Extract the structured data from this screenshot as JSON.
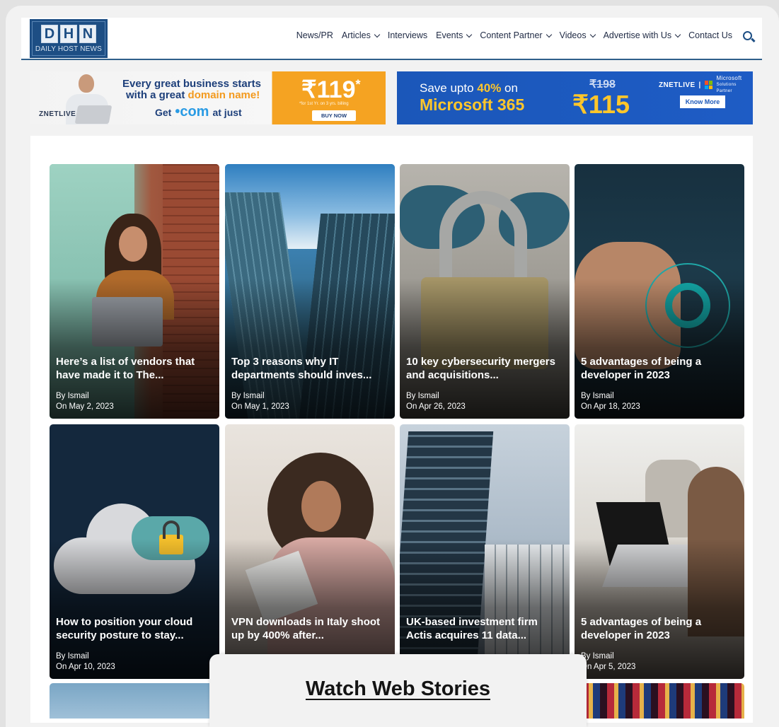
{
  "site": {
    "logo_letters": [
      "D",
      "H",
      "N"
    ],
    "logo_subtitle": "DAILY HOST NEWS"
  },
  "nav": {
    "items": [
      {
        "label": "News/PR",
        "dropdown": false
      },
      {
        "label": "Articles",
        "dropdown": true
      },
      {
        "label": "Interviews",
        "dropdown": false
      },
      {
        "label": "Events",
        "dropdown": true
      },
      {
        "label": "Content Partner",
        "dropdown": true
      },
      {
        "label": "Videos",
        "dropdown": true
      },
      {
        "label": "Advertise with Us",
        "dropdown": true
      },
      {
        "label": "Contact Us",
        "dropdown": false
      }
    ],
    "search_icon": "search-icon"
  },
  "banner_domain": {
    "line1": "Every great business starts",
    "line2_pre": "with a great ",
    "line2_highlight": "domain name!",
    "line3_pre": "Get",
    "line3_com": "•com",
    "line3_post": "at just",
    "price": "₹119",
    "price_mark": "*",
    "fine_print": "*for 1st Yr. on 3 yrs. billing",
    "cta": "BUY NOW",
    "brand": "ZNETLIVE"
  },
  "banner_microsoft": {
    "line1_pre": "Save upto ",
    "line1_highlight": "40%",
    "line1_post": " on",
    "line2": "Microsoft 365",
    "old_price": "₹198",
    "price": "₹115",
    "brand": "ZNETLIVE",
    "partner_line1": "Microsoft",
    "partner_line2": "Solutions Partner",
    "cta": "Know More"
  },
  "articles": [
    {
      "title": "Here’s a list of vendors that have made it to The...",
      "author": "By Ismail",
      "date": "On May 2, 2023"
    },
    {
      "title": "Top 3 reasons why IT departments should inves...",
      "author": "By Ismail",
      "date": "On May 1, 2023"
    },
    {
      "title": "10 key cybersecurity mergers and acquisitions...",
      "author": "By Ismail",
      "date": "On Apr 26, 2023"
    },
    {
      "title": "5 advantages of being a developer in 2023",
      "author": "By Ismail",
      "date": "On Apr 18, 2023"
    },
    {
      "title": "How to position your cloud security posture to stay...",
      "author": "By Ismail",
      "date": "On Apr 10, 2023"
    },
    {
      "title": "VPN downloads in Italy shoot up by 400% after...",
      "author": "",
      "date": ""
    },
    {
      "title": "UK-based investment firm Actis acquires 11 data...",
      "author": "",
      "date": ""
    },
    {
      "title": "5 advantages of being a developer in 2023",
      "author": "By Ismail",
      "date": "On Apr 5, 2023"
    }
  ],
  "web_stories": {
    "label": "Watch Web Stories"
  },
  "colors": {
    "brand_blue": "#1d4e84",
    "banner_orange": "#f5a322",
    "banner_blue": "#1b57b9",
    "highlight_yellow": "#ffc62b"
  }
}
